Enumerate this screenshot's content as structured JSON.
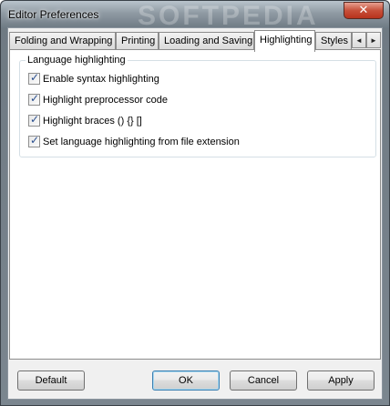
{
  "window": {
    "title": "Editor Preferences",
    "close_symbol": "✕"
  },
  "tabs": [
    {
      "label": "Folding and Wrapping",
      "active": false
    },
    {
      "label": "Printing",
      "active": false
    },
    {
      "label": "Loading and Saving",
      "active": false
    },
    {
      "label": "Highlighting",
      "active": true
    },
    {
      "label": "Styles",
      "active": false
    }
  ],
  "tab_scroll": {
    "left": "◄",
    "right": "►"
  },
  "group": {
    "title": "Language highlighting",
    "options": [
      {
        "label": "Enable syntax highlighting",
        "checked": true
      },
      {
        "label": "Highlight preprocessor code",
        "checked": true
      },
      {
        "label": "Highlight braces () {} []",
        "checked": true
      },
      {
        "label": "Set language highlighting from file extension",
        "checked": true
      }
    ]
  },
  "buttons": {
    "default": "Default",
    "ok": "OK",
    "cancel": "Cancel",
    "apply": "Apply"
  }
}
